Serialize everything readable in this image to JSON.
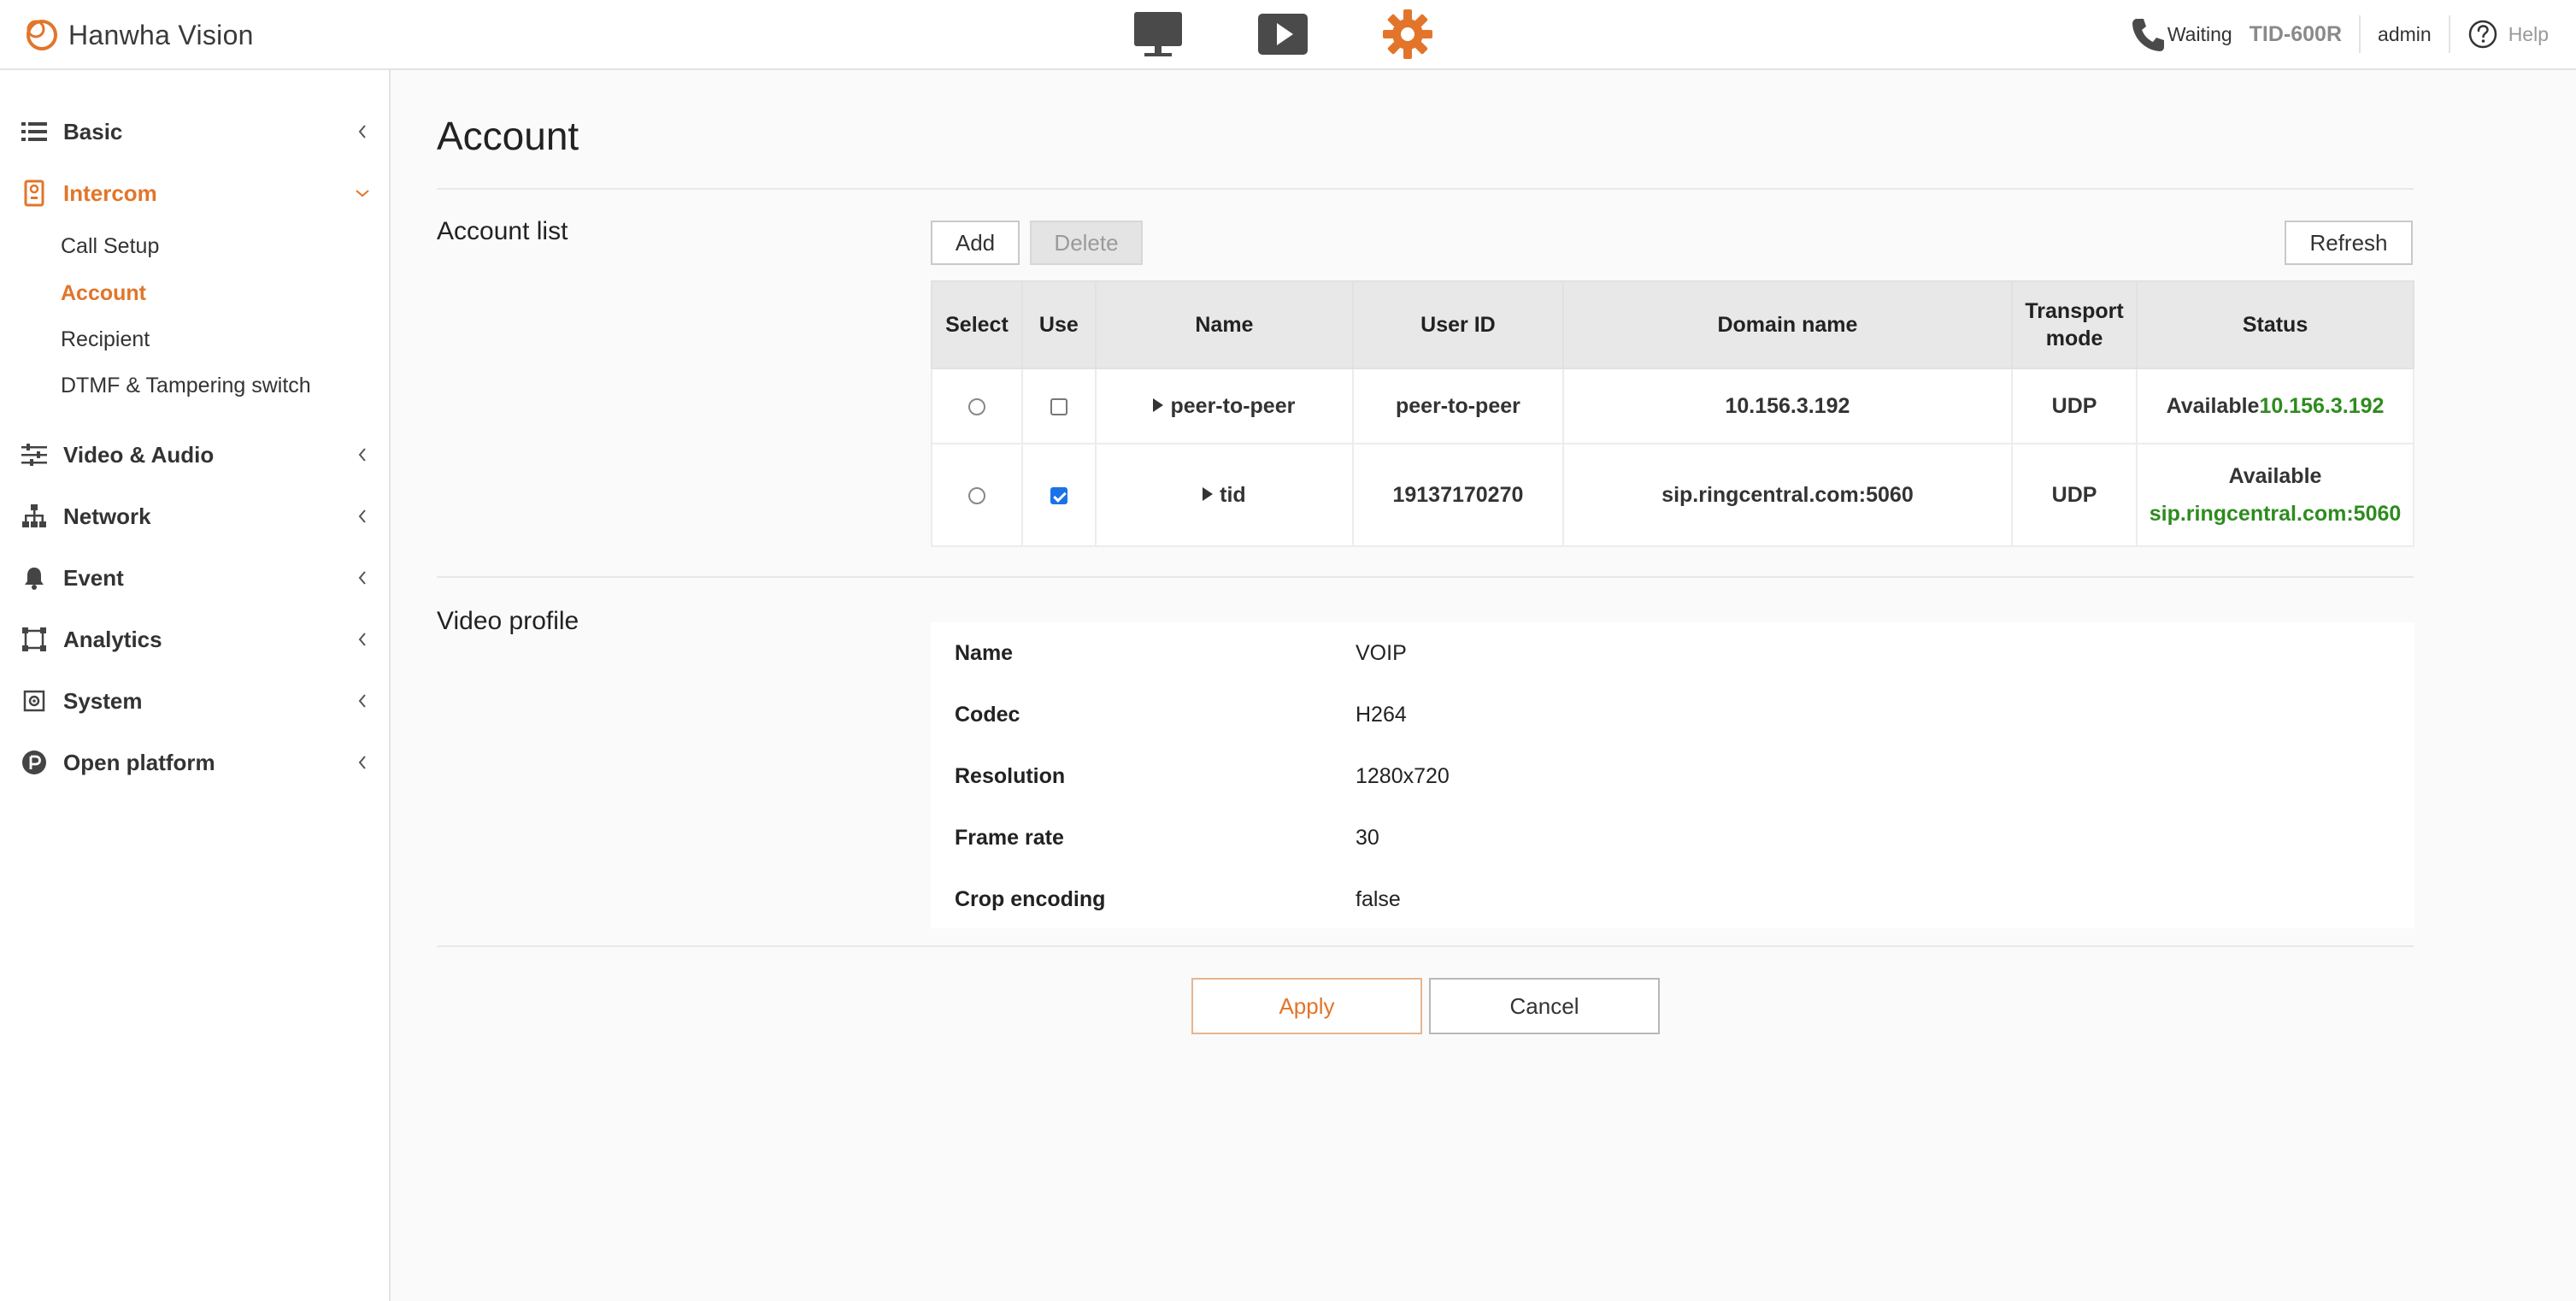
{
  "header": {
    "brand": "Hanwha Vision",
    "nav": [
      {
        "name": "monitor-icon"
      },
      {
        "name": "play-icon"
      },
      {
        "name": "gear-icon"
      }
    ],
    "call_status": "Waiting",
    "device_model": "TID-600R",
    "user": "admin",
    "help": "Help",
    "accent_color": "#e2752a"
  },
  "sidebar": {
    "menu": [
      {
        "label": "Basic",
        "icon": "list-icon"
      },
      {
        "label": "Intercom",
        "icon": "intercom-icon"
      },
      {
        "label": "Video & Audio",
        "icon": "sliders-icon"
      },
      {
        "label": "Network",
        "icon": "network-icon"
      },
      {
        "label": "Event",
        "icon": "bell-icon"
      },
      {
        "label": "Analytics",
        "icon": "analytics-icon"
      },
      {
        "label": "System",
        "icon": "system-icon"
      },
      {
        "label": "Open platform",
        "icon": "open-platform-icon"
      }
    ],
    "intercom_submenu": [
      "Call Setup",
      "Account",
      "Recipient",
      "DTMF & Tampering switch"
    ]
  },
  "main": {
    "title": "Account",
    "account_list": {
      "label": "Account list",
      "add": "Add",
      "delete": "Delete",
      "refresh": "Refresh",
      "columns": [
        "Select",
        "Use",
        "Name",
        "User ID",
        "Domain name",
        "Transport mode",
        "Status"
      ],
      "rows": [
        {
          "selected": false,
          "use": false,
          "name": "peer-to-peer",
          "user_id": "peer-to-peer",
          "domain": "10.156.3.192",
          "transport": "UDP",
          "status_text": "Available",
          "status_addr": "10.156.3.192"
        },
        {
          "selected": false,
          "use": true,
          "name": "tid",
          "user_id": "19137170270",
          "domain": "sip.ringcentral.com:5060",
          "transport": "UDP",
          "status_text": "Available",
          "status_addr": "sip.ringcentral.com:5060"
        }
      ]
    },
    "video_profile": {
      "label": "Video profile",
      "rows": [
        {
          "key": "Name",
          "value": "VOIP"
        },
        {
          "key": "Codec",
          "value": "H264"
        },
        {
          "key": "Resolution",
          "value": "1280x720"
        },
        {
          "key": "Frame rate",
          "value": "30"
        },
        {
          "key": "Crop encoding",
          "value": "false"
        }
      ]
    },
    "apply": "Apply",
    "cancel": "Cancel"
  }
}
